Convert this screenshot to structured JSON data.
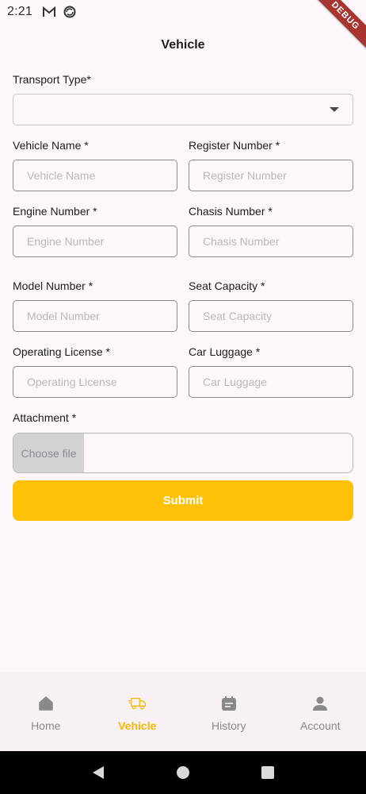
{
  "status": {
    "time": "2:21"
  },
  "debug_banner": "DEBUG",
  "page_title": "Vehicle",
  "form": {
    "transport_type": {
      "label": "Transport Type*",
      "value": ""
    },
    "vehicle_name": {
      "label": "Vehicle Name *",
      "placeholder": "Vehicle Name"
    },
    "register_number": {
      "label": "Register Number *",
      "placeholder": "Register Number"
    },
    "engine_number": {
      "label": "Engine Number *",
      "placeholder": "Engine Number"
    },
    "chasis_number": {
      "label": "Chasis Number *",
      "placeholder": "Chasis Number"
    },
    "model_number": {
      "label": "Model Number *",
      "placeholder": "Model Number"
    },
    "seat_capacity": {
      "label": "Seat Capacity *",
      "placeholder": "Seat Capacity"
    },
    "operating_license": {
      "label": "Operating License *",
      "placeholder": "Operating License"
    },
    "car_luggage": {
      "label": "Car Luggage *",
      "placeholder": "Car Luggage"
    },
    "attachment": {
      "label": "Attachment *",
      "button": "Choose file"
    },
    "submit_label": "Submit"
  },
  "bottom_nav": [
    {
      "label": "Home",
      "icon": "home-icon",
      "active": false
    },
    {
      "label": "Vehicle",
      "icon": "truck-icon",
      "active": true
    },
    {
      "label": "History",
      "icon": "calendar-history-icon",
      "active": false
    },
    {
      "label": "Account",
      "icon": "person-icon",
      "active": false
    }
  ],
  "colors": {
    "accent": "#ffc107",
    "active_nav": "#f5b800",
    "background": "#fdf7fb"
  }
}
